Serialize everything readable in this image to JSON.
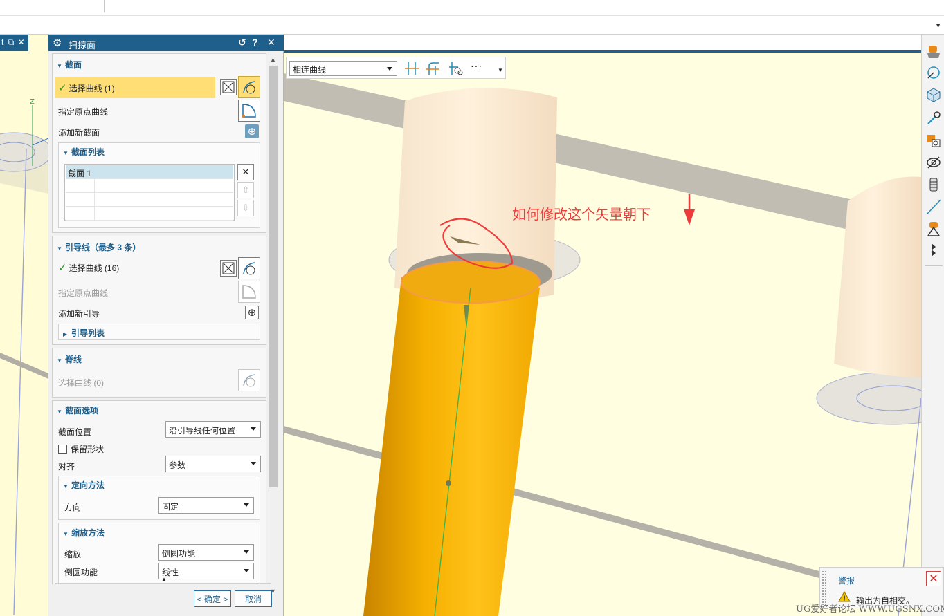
{
  "left_tab": {
    "label": "t"
  },
  "dialog": {
    "title": "扫掠面",
    "section": {
      "header": "截面",
      "select_curve": "选择曲线 (1)",
      "origin_curve": "指定原点曲线",
      "add_new": "添加新截面",
      "list": {
        "header": "截面列表",
        "rows": [
          "截面 1",
          "",
          "",
          ""
        ]
      }
    },
    "guide": {
      "header": "引导线（最多 3 条）",
      "select_curve": "选择曲线 (16)",
      "origin_curve": "指定原点曲线",
      "add_new": "添加新引导",
      "list_header": "引导列表"
    },
    "spine": {
      "header": "脊线",
      "select_curve": "选择曲线 (0)"
    },
    "section_options": {
      "header": "截面选项",
      "position_label": "截面位置",
      "position_value": "沿引导线任何位置",
      "keep_shape": "保留形状",
      "align_label": "对齐",
      "align_value": "参数",
      "orientation": {
        "header": "定向方法",
        "direction_label": "方向",
        "direction_value": "固定"
      },
      "scaling": {
        "header": "缩放方法",
        "scale_label": "缩放",
        "scale_value": "倒圆功能",
        "fillet_label": "倒圆功能",
        "fillet_value": "线性"
      }
    },
    "ok_button": "< 确定 >",
    "cancel_button": "取消"
  },
  "selection_bar": {
    "filter_value": "相连曲线",
    "more": "···"
  },
  "annotation": "如何修改这个矢量朝下",
  "alert": {
    "title": "警报",
    "message": "输出为自相交。"
  },
  "watermark": "UG爱好者论坛 WWW.UGSNX.COM",
  "colors": {
    "title_bar": "#1f5f8b",
    "selection_highlight": "#ffdf75",
    "background_yellow": "#fffee0",
    "annotation_red": "#ee3a3a",
    "solid_orange": "#f5b000"
  }
}
